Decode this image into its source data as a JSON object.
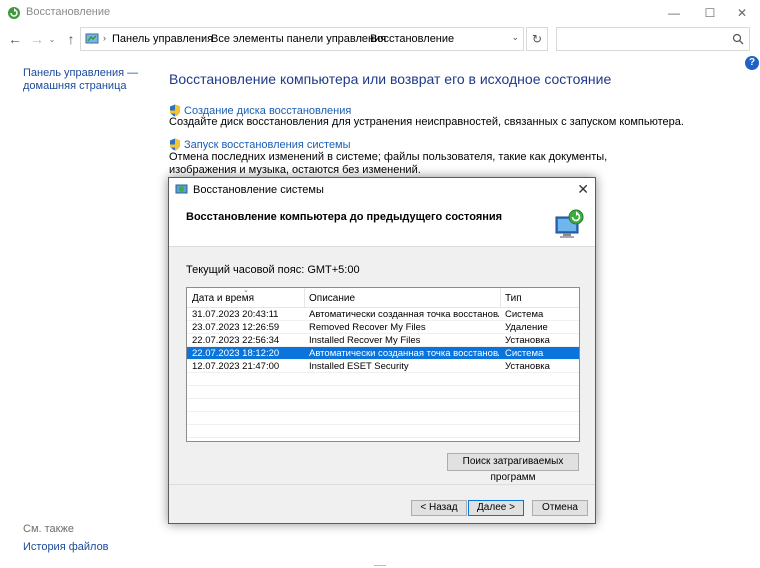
{
  "window": {
    "title": "Восстановление",
    "controls": {
      "minimize": "—",
      "maximize": "☐",
      "close": "✕"
    }
  },
  "nav": {
    "back": "←",
    "forward": "→",
    "history": "⌄",
    "up": "↑",
    "refresh": "↻"
  },
  "address": {
    "sep": "›",
    "crumbs": [
      "Панель управления",
      "Все элементы панели управления",
      "Восстановление"
    ],
    "dropdown": "⌄"
  },
  "search": {
    "placeholder": ""
  },
  "help": "?",
  "sidebar": {
    "home_line1": "Панель управления —",
    "home_line2": "домашняя страница",
    "see_also": "См. также",
    "file_history": "История файлов"
  },
  "main": {
    "title": "Восстановление компьютера или возврат его в исходное состояние",
    "link1": "Создание диска восстановления",
    "desc1": "Создайте диск восстановления для устранения неисправностей, связанных с запуском компьютера.",
    "link2": "Запуск восстановления системы",
    "desc2": "Отмена последних изменений в системе; файлы пользователя, такие как документы, изображения и музыка, остаются без изменений."
  },
  "dialog": {
    "title": "Восстановление системы",
    "close": "✕",
    "heading": "Восстановление компьютера до предыдущего состояния",
    "timezone": "Текущий часовой пояс: GMT+5:00",
    "columns": {
      "date": "Дата и время",
      "desc": "Описание",
      "type": "Тип"
    },
    "sort_indicator": "⌄",
    "rows": [
      {
        "date": "31.07.2023 20:43:11",
        "desc": "Автоматически созданная точка восстановле…",
        "type": "Система"
      },
      {
        "date": "23.07.2023 12:26:59",
        "desc": "Removed Recover My Files",
        "type": "Удаление"
      },
      {
        "date": "22.07.2023 22:56:34",
        "desc": "Installed Recover My Files",
        "type": "Установка"
      },
      {
        "date": "22.07.2023 18:12:20",
        "desc": "Автоматически созданная точка восстановле…",
        "type": "Система"
      },
      {
        "date": "12.07.2023 21:47:00",
        "desc": "Installed ESET Security",
        "type": "Установка"
      }
    ],
    "scan_button": "Поиск затрагиваемых программ",
    "back_button": "< Назад",
    "next_button": "Далее >",
    "cancel_button": "Отмена"
  },
  "colors": {
    "link": "#1a5fb4",
    "title": "#1e3a8a",
    "selection": "#0a74da"
  }
}
